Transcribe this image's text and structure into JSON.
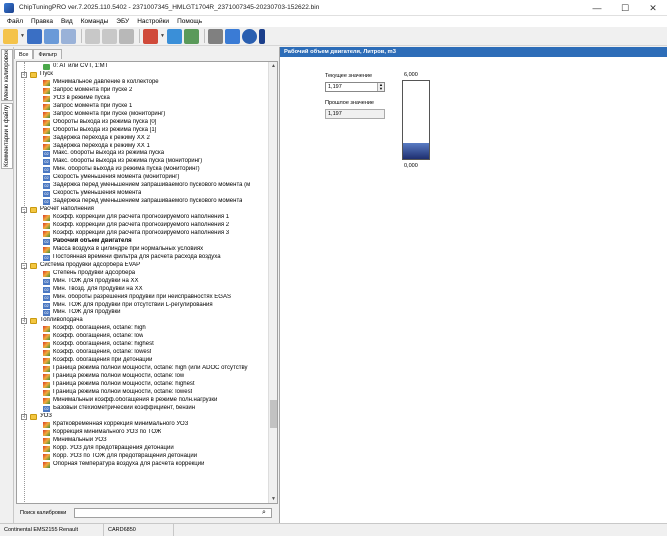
{
  "window": {
    "title": "ChipTuningPRO ver.7.2025.110.5402 - 2371007345_HMLGT1704R_2371007345-20230703-152622.bin",
    "controls": [
      "—",
      "☐",
      "✕"
    ]
  },
  "menu": [
    "Файл",
    "Правка",
    "Вид",
    "Команды",
    "ЭБУ",
    "Настройки",
    "Помощь"
  ],
  "toolbar": {
    "icons": [
      "open-icon",
      "save-icon",
      "save-as-icon",
      "undo-icon",
      "copy-icon",
      "paste-icon",
      "calc-icon",
      "compare-icon",
      "nav-icon",
      "search-icon",
      "tools-icon",
      "connect-icon",
      "help-icon",
      "extra-icon"
    ]
  },
  "side_tabs": [
    "Меню калибровок",
    "Комментарии к файлу"
  ],
  "left_tabs": [
    "Все",
    "Фильтр"
  ],
  "tree": [
    {
      "level": 2,
      "icon": "check",
      "label": "0: AT или CVT, 1:MT"
    },
    {
      "level": 0,
      "icon": "folder",
      "label": "Пуск",
      "expander": "-"
    },
    {
      "level": 1,
      "icon": "map3d",
      "label": "Минимальное давление в коллекторе"
    },
    {
      "level": 1,
      "icon": "map3d",
      "label": "Запрос момента при пуске 2"
    },
    {
      "level": 1,
      "icon": "map3d",
      "label": "УОЗ в режиме пуска"
    },
    {
      "level": 1,
      "icon": "map3d",
      "label": "Запрос момента при пуске 1"
    },
    {
      "level": 1,
      "icon": "map3d",
      "label": "Запрос момента при пуске (мониторинг)"
    },
    {
      "level": 1,
      "icon": "map3d",
      "label": "Обороты выхода из режима пуска [0]"
    },
    {
      "level": 1,
      "icon": "map3d",
      "label": "Обороты выхода из режима пуска [1]"
    },
    {
      "level": 1,
      "icon": "map3d",
      "label": "Задержка перехода к режиму ХХ 2"
    },
    {
      "level": 1,
      "icon": "map3d",
      "label": "Задержка перехода к режиму ХХ 1"
    },
    {
      "level": 1,
      "icon": "map2d",
      "label": "Макс. обороты выхода из режима пуска"
    },
    {
      "level": 1,
      "icon": "map2d",
      "label": "Макс. обороты выхода из режима пуска (мониторинг)"
    },
    {
      "level": 1,
      "icon": "map2d",
      "label": "Мин. обороты выхода из режима пуска (мониторинг)"
    },
    {
      "level": 1,
      "icon": "map2d",
      "label": "Скорость уменьшения момента (мониторинг)"
    },
    {
      "level": 1,
      "icon": "map2d",
      "label": "Задержка перед уменьшением запрашиваемого пускового момента (м"
    },
    {
      "level": 1,
      "icon": "map2d",
      "label": "Скорость уменьшения момента"
    },
    {
      "level": 1,
      "icon": "map2d",
      "label": "Задержка перед уменьшением запрашиваемого пускового момента"
    },
    {
      "level": 0,
      "icon": "folder",
      "label": "Расчет наполнения",
      "expander": "-"
    },
    {
      "level": 1,
      "icon": "map3d",
      "label": "Коэфф. коррекции для расчета прогнозируемого наполнения 1"
    },
    {
      "level": 1,
      "icon": "map3d",
      "label": "Коэфф. коррекции для расчета прогнозируемого наполнения 2"
    },
    {
      "level": 1,
      "icon": "map3d",
      "label": "Коэфф. коррекции для расчета прогнозируемого наполнения 3"
    },
    {
      "level": 1,
      "icon": "map2d",
      "label": "Рабочий объем двигателя",
      "selected": true
    },
    {
      "level": 1,
      "icon": "map3d",
      "label": "Масса воздуха в цилиндре при нормальных условиях"
    },
    {
      "level": 1,
      "icon": "map2d",
      "label": "Постоянная времени фильтра для расчета расхода воздуха"
    },
    {
      "level": 0,
      "icon": "folder",
      "label": "Система продувки адсорбера EVAP",
      "expander": "-"
    },
    {
      "level": 1,
      "icon": "map3d",
      "label": "Степень продувки адсорбера"
    },
    {
      "level": 1,
      "icon": "map2d",
      "label": "Мин. ТОЖ для продувки на ХХ"
    },
    {
      "level": 1,
      "icon": "map2d",
      "label": "Мин. Твозд. для продувки на ХХ"
    },
    {
      "level": 1,
      "icon": "map2d",
      "label": "Мин. обороты разрешения продувки при неисправностях EGAS"
    },
    {
      "level": 1,
      "icon": "map2d",
      "label": "Мин. ТОЖ для продувки при отсутствии L-регулирования"
    },
    {
      "level": 1,
      "icon": "map2d",
      "label": "Мин. ТОЖ для продувки"
    },
    {
      "level": 0,
      "icon": "folder",
      "label": "Топливоподача",
      "expander": "-"
    },
    {
      "level": 1,
      "icon": "map3d",
      "label": "Коэфф. обогащения, octane: high"
    },
    {
      "level": 1,
      "icon": "map3d",
      "label": "Коэфф. обогащения, octane: low"
    },
    {
      "level": 1,
      "icon": "map3d",
      "label": "Коэфф. обогащения, octane: highest"
    },
    {
      "level": 1,
      "icon": "map3d",
      "label": "Коэфф. обогащения, octane: lowest"
    },
    {
      "level": 1,
      "icon": "map3d",
      "label": "Коэфф. обогащения при детонации"
    },
    {
      "level": 1,
      "icon": "map3d",
      "label": "Граница режима полной мощности, octane: high (или ADOC отсутству"
    },
    {
      "level": 1,
      "icon": "map3d",
      "label": "Граница режима полной мощности, octane: low"
    },
    {
      "level": 1,
      "icon": "map3d",
      "label": "Граница режима полной мощности, octane: highest"
    },
    {
      "level": 1,
      "icon": "map3d",
      "label": "Граница режима полной мощности, octane: lowest"
    },
    {
      "level": 1,
      "icon": "map3d",
      "label": "Минимальный коэфф.обогащения в режиме полн.нагрузки"
    },
    {
      "level": 1,
      "icon": "map2d",
      "label": "Базовый стехиометрический коэффициент, бензин"
    },
    {
      "level": 0,
      "icon": "folder",
      "label": "УОЗ",
      "expander": "-"
    },
    {
      "level": 1,
      "icon": "map3d",
      "label": "Кратковременная коррекция минимального УОЗ"
    },
    {
      "level": 1,
      "icon": "map3d",
      "label": "Коррекция минимального УОЗ по ТОЖ"
    },
    {
      "level": 1,
      "icon": "map3d",
      "label": "Минимальный УОЗ"
    },
    {
      "level": 1,
      "icon": "map3d",
      "label": "Корр. УОЗ для предотвращения детонации"
    },
    {
      "level": 1,
      "icon": "map3d",
      "label": "Корр. УОЗ по ТОЖ для предотвращения детонации"
    },
    {
      "level": 1,
      "icon": "map3d",
      "label": "Опорная температура воздуха для расчёта коррекции"
    }
  ],
  "search": {
    "label": "Поиск калибровки",
    "value": ""
  },
  "panel": {
    "title": "Рабочий объем двигателя, Литров, m3",
    "current_label": "Текущее значение",
    "current_value": "1,197",
    "previous_label": "Прошлое значение",
    "previous_value": "1,197",
    "gauge_max": "6,000",
    "gauge_min": "0,000",
    "gauge_fraction": 0.2
  },
  "status": [
    "Continental EMS2155 Renault",
    "CARD6850"
  ]
}
